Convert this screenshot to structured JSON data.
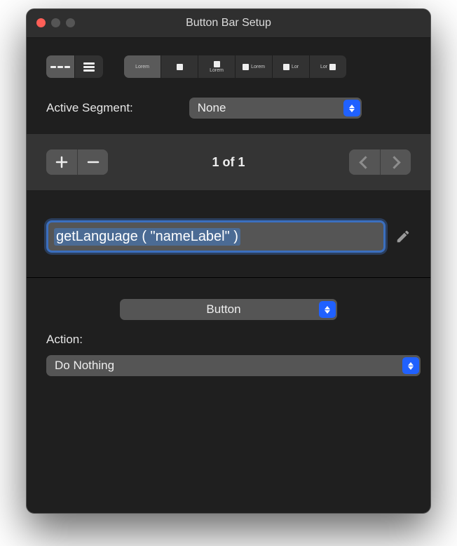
{
  "window": {
    "title": "Button Bar Setup"
  },
  "top": {
    "label_options": [
      "Lorem",
      "Lorem",
      "Lorem",
      "Lor",
      "Lor"
    ]
  },
  "active_segment": {
    "label": "Active Segment:",
    "value": "None"
  },
  "counter": {
    "text": "1 of 1"
  },
  "name": {
    "value": "getLanguage ( \"nameLabel\" )"
  },
  "type": {
    "value": "Button"
  },
  "action": {
    "label": "Action:",
    "value": "Do Nothing"
  }
}
